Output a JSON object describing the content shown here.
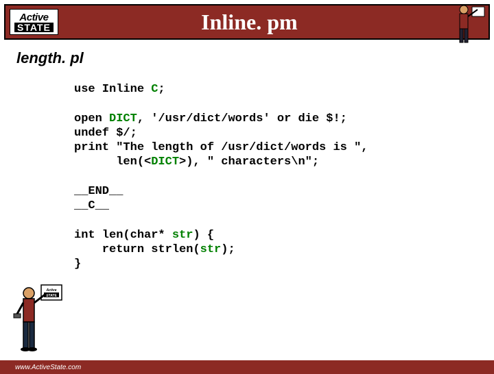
{
  "logo": {
    "top": "Active",
    "bottom": "STATE"
  },
  "title": "Inline. pm",
  "subtitle": "length. pl",
  "code": {
    "l1a": "use Inline ",
    "l1b": "C",
    "l1c": ";",
    "blank1": "",
    "l2a": "open ",
    "l2b": "DICT",
    "l2c": ", '/usr/dict/words' or die $!;",
    "l3": "undef $/;",
    "l4": "print \"The length of /usr/dict/words is \",",
    "l5a": "      len(<",
    "l5b": "DICT",
    "l5c": ">), \" characters\\n\";",
    "blank2": "",
    "l6": "__END__",
    "l7": "__C__",
    "blank3": "",
    "l8a": "int len(char* ",
    "l8b": "str",
    "l8c": ") {",
    "l9a": "    return strlen(",
    "l9b": "str",
    "l9c": ");",
    "l10": "}"
  },
  "footer": {
    "url": "www.ActiveState.com"
  },
  "icons": {
    "header_figure": "painter-figure-icon",
    "corner_figure": "painter-figure-icon"
  },
  "colors": {
    "brand": "#8c2a24",
    "keyword": "#008000"
  }
}
